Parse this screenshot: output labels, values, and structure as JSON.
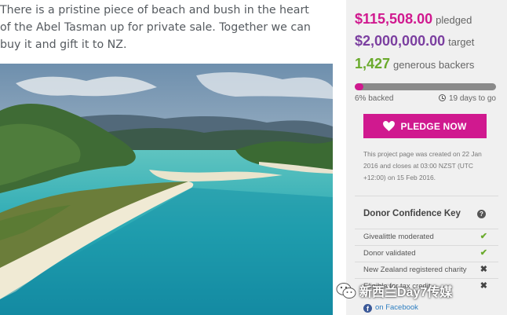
{
  "campaign": {
    "intro_lines": [
      "There is a pristine piece of beach and bush in the heart",
      "of the Abel Tasman up for private sale. Together we can",
      "buy it and gift it to NZ."
    ],
    "photo_icon": "beach-landscape-image"
  },
  "stats": {
    "pledged_amount": "$115,508.00",
    "pledged_label": "pledged",
    "target_amount": "$2,000,000.00",
    "target_label": "target",
    "backers_count": "1,427",
    "backers_label": "generous backers",
    "progress_fraction": 0.06,
    "backed_text": "6% backed",
    "days_to_go": "19 days to go"
  },
  "pledge_button": {
    "label": "PLEDGE NOW",
    "icon": "heart-icon"
  },
  "info_text": "This project page was created on 22 Jan 2016 and closes at 03:00 NZST (UTC +12:00) on 15 Feb 2016.",
  "confidence": {
    "title": "Donor Confidence Key",
    "help_icon": "?",
    "items": [
      {
        "label": "Givealittle moderated",
        "mark": "✔"
      },
      {
        "label": "Donor validated",
        "mark": "✔"
      },
      {
        "label": "New Zealand registered charity",
        "mark": "✖"
      },
      {
        "label": "Eligible for tax credit",
        "mark": "✖"
      }
    ]
  },
  "facebook": {
    "label": "on Facebook",
    "icon": "f"
  },
  "watermark": {
    "text": "新西兰Day7传媒"
  },
  "colors": {
    "accent": "#d0198f",
    "target": "#7b3fa0",
    "backers": "#6aaa2c",
    "check": "#6aaa2c"
  }
}
